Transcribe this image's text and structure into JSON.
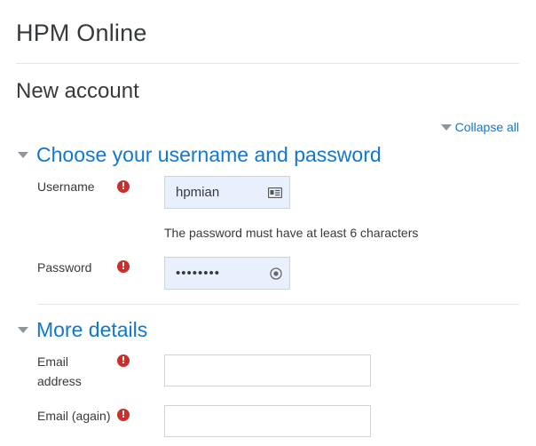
{
  "site": {
    "title": "HPM Online"
  },
  "page": {
    "heading": "New account",
    "collapse_all": "Collapse all"
  },
  "sections": [
    {
      "title": "Choose your username and password"
    },
    {
      "title": "More details"
    }
  ],
  "fields": {
    "username": {
      "label": "Username",
      "value": "hpmian"
    },
    "password_hint": "The password must have at least 6 characters",
    "password": {
      "label": "Password",
      "value": "••••••••"
    },
    "email": {
      "label": "Email address",
      "value": ""
    },
    "email_again": {
      "label": "Email (again)",
      "value": ""
    }
  },
  "colors": {
    "link": "#1177d1",
    "required": "#c9302c",
    "autofill": "#e8f0fe"
  },
  "icons": {
    "collapse": "triangle-down",
    "required": "exclamation-circle",
    "username_field": "contact-card",
    "password_field": "key-circle"
  }
}
